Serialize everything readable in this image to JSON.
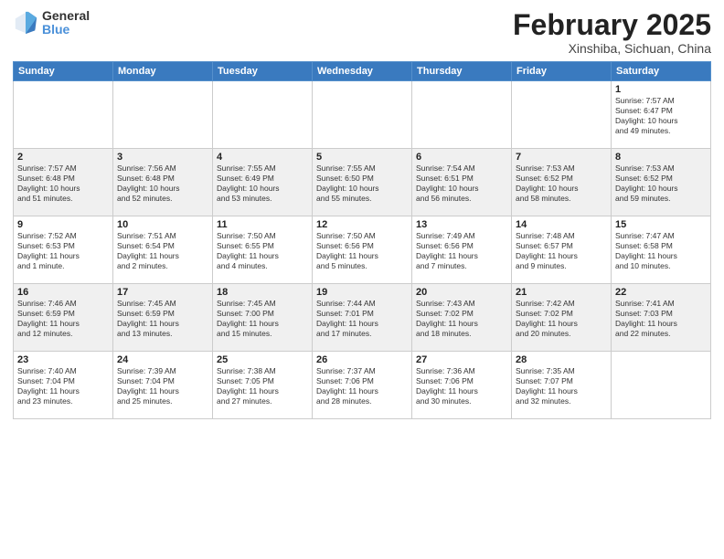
{
  "header": {
    "logo_general": "General",
    "logo_blue": "Blue",
    "month_title": "February 2025",
    "location": "Xinshiba, Sichuan, China"
  },
  "days_of_week": [
    "Sunday",
    "Monday",
    "Tuesday",
    "Wednesday",
    "Thursday",
    "Friday",
    "Saturday"
  ],
  "weeks": [
    [
      {
        "day": "",
        "info": ""
      },
      {
        "day": "",
        "info": ""
      },
      {
        "day": "",
        "info": ""
      },
      {
        "day": "",
        "info": ""
      },
      {
        "day": "",
        "info": ""
      },
      {
        "day": "",
        "info": ""
      },
      {
        "day": "1",
        "info": "Sunrise: 7:57 AM\nSunset: 6:47 PM\nDaylight: 10 hours\nand 49 minutes."
      }
    ],
    [
      {
        "day": "2",
        "info": "Sunrise: 7:57 AM\nSunset: 6:48 PM\nDaylight: 10 hours\nand 51 minutes."
      },
      {
        "day": "3",
        "info": "Sunrise: 7:56 AM\nSunset: 6:48 PM\nDaylight: 10 hours\nand 52 minutes."
      },
      {
        "day": "4",
        "info": "Sunrise: 7:55 AM\nSunset: 6:49 PM\nDaylight: 10 hours\nand 53 minutes."
      },
      {
        "day": "5",
        "info": "Sunrise: 7:55 AM\nSunset: 6:50 PM\nDaylight: 10 hours\nand 55 minutes."
      },
      {
        "day": "6",
        "info": "Sunrise: 7:54 AM\nSunset: 6:51 PM\nDaylight: 10 hours\nand 56 minutes."
      },
      {
        "day": "7",
        "info": "Sunrise: 7:53 AM\nSunset: 6:52 PM\nDaylight: 10 hours\nand 58 minutes."
      },
      {
        "day": "8",
        "info": "Sunrise: 7:53 AM\nSunset: 6:52 PM\nDaylight: 10 hours\nand 59 minutes."
      }
    ],
    [
      {
        "day": "9",
        "info": "Sunrise: 7:52 AM\nSunset: 6:53 PM\nDaylight: 11 hours\nand 1 minute."
      },
      {
        "day": "10",
        "info": "Sunrise: 7:51 AM\nSunset: 6:54 PM\nDaylight: 11 hours\nand 2 minutes."
      },
      {
        "day": "11",
        "info": "Sunrise: 7:50 AM\nSunset: 6:55 PM\nDaylight: 11 hours\nand 4 minutes."
      },
      {
        "day": "12",
        "info": "Sunrise: 7:50 AM\nSunset: 6:56 PM\nDaylight: 11 hours\nand 5 minutes."
      },
      {
        "day": "13",
        "info": "Sunrise: 7:49 AM\nSunset: 6:56 PM\nDaylight: 11 hours\nand 7 minutes."
      },
      {
        "day": "14",
        "info": "Sunrise: 7:48 AM\nSunset: 6:57 PM\nDaylight: 11 hours\nand 9 minutes."
      },
      {
        "day": "15",
        "info": "Sunrise: 7:47 AM\nSunset: 6:58 PM\nDaylight: 11 hours\nand 10 minutes."
      }
    ],
    [
      {
        "day": "16",
        "info": "Sunrise: 7:46 AM\nSunset: 6:59 PM\nDaylight: 11 hours\nand 12 minutes."
      },
      {
        "day": "17",
        "info": "Sunrise: 7:45 AM\nSunset: 6:59 PM\nDaylight: 11 hours\nand 13 minutes."
      },
      {
        "day": "18",
        "info": "Sunrise: 7:45 AM\nSunset: 7:00 PM\nDaylight: 11 hours\nand 15 minutes."
      },
      {
        "day": "19",
        "info": "Sunrise: 7:44 AM\nSunset: 7:01 PM\nDaylight: 11 hours\nand 17 minutes."
      },
      {
        "day": "20",
        "info": "Sunrise: 7:43 AM\nSunset: 7:02 PM\nDaylight: 11 hours\nand 18 minutes."
      },
      {
        "day": "21",
        "info": "Sunrise: 7:42 AM\nSunset: 7:02 PM\nDaylight: 11 hours\nand 20 minutes."
      },
      {
        "day": "22",
        "info": "Sunrise: 7:41 AM\nSunset: 7:03 PM\nDaylight: 11 hours\nand 22 minutes."
      }
    ],
    [
      {
        "day": "23",
        "info": "Sunrise: 7:40 AM\nSunset: 7:04 PM\nDaylight: 11 hours\nand 23 minutes."
      },
      {
        "day": "24",
        "info": "Sunrise: 7:39 AM\nSunset: 7:04 PM\nDaylight: 11 hours\nand 25 minutes."
      },
      {
        "day": "25",
        "info": "Sunrise: 7:38 AM\nSunset: 7:05 PM\nDaylight: 11 hours\nand 27 minutes."
      },
      {
        "day": "26",
        "info": "Sunrise: 7:37 AM\nSunset: 7:06 PM\nDaylight: 11 hours\nand 28 minutes."
      },
      {
        "day": "27",
        "info": "Sunrise: 7:36 AM\nSunset: 7:06 PM\nDaylight: 11 hours\nand 30 minutes."
      },
      {
        "day": "28",
        "info": "Sunrise: 7:35 AM\nSunset: 7:07 PM\nDaylight: 11 hours\nand 32 minutes."
      },
      {
        "day": "",
        "info": ""
      }
    ]
  ]
}
